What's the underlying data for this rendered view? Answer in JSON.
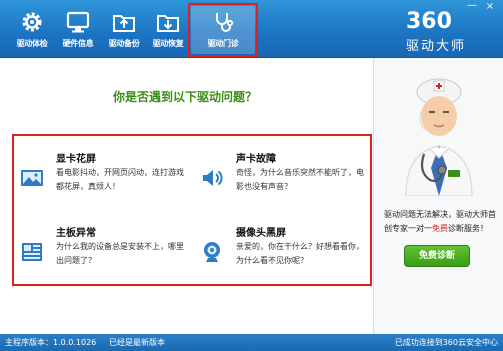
{
  "header": {
    "nav": [
      {
        "label": "驱动体检",
        "icon": "gear-icon"
      },
      {
        "label": "硬件信息",
        "icon": "monitor-icon"
      },
      {
        "label": "驱动备份",
        "icon": "backup-folder-icon"
      },
      {
        "label": "驱动恢复",
        "icon": "restore-folder-icon"
      },
      {
        "label": "驱动门诊",
        "icon": "stethoscope-icon"
      }
    ],
    "active_index": 4,
    "logo_number": "360",
    "logo_text": "驱动大师",
    "minimize_symbol": "—",
    "close_symbol": "×"
  },
  "main": {
    "question": "你是否遇到以下驱动问题？",
    "problems": [
      {
        "title": "显卡花屏",
        "desc": "看电影抖动，开网页闪动，连打游戏都花屏，真烦人！",
        "icon": "picture-icon"
      },
      {
        "title": "声卡故障",
        "desc": "奇怪，为什么音乐突然不能听了，电影也没有声音？",
        "icon": "speaker-icon"
      },
      {
        "title": "主板异常",
        "desc": "为什么我的设备总是安装不上，哪里出问题了？",
        "icon": "motherboard-icon"
      },
      {
        "title": "摄像头黑屏",
        "desc": "亲爱的，你在干什么？好想看看你，为什么看不见你呢？",
        "icon": "webcam-icon"
      }
    ]
  },
  "side": {
    "text_before": "驱动问题无法解决，驱动大师首创专家一对一",
    "text_free": "免费",
    "text_after": "诊断服务！",
    "button_label": "免费诊断"
  },
  "status": {
    "version": "主程序版本：1.0.0.1026",
    "version_state": "已经是最新版本",
    "connection": "已成功连接到360云安全中心"
  },
  "colors": {
    "header_blue": "#1c74c2",
    "accent_green": "#3a8e15",
    "highlight_red": "#e0201c"
  }
}
